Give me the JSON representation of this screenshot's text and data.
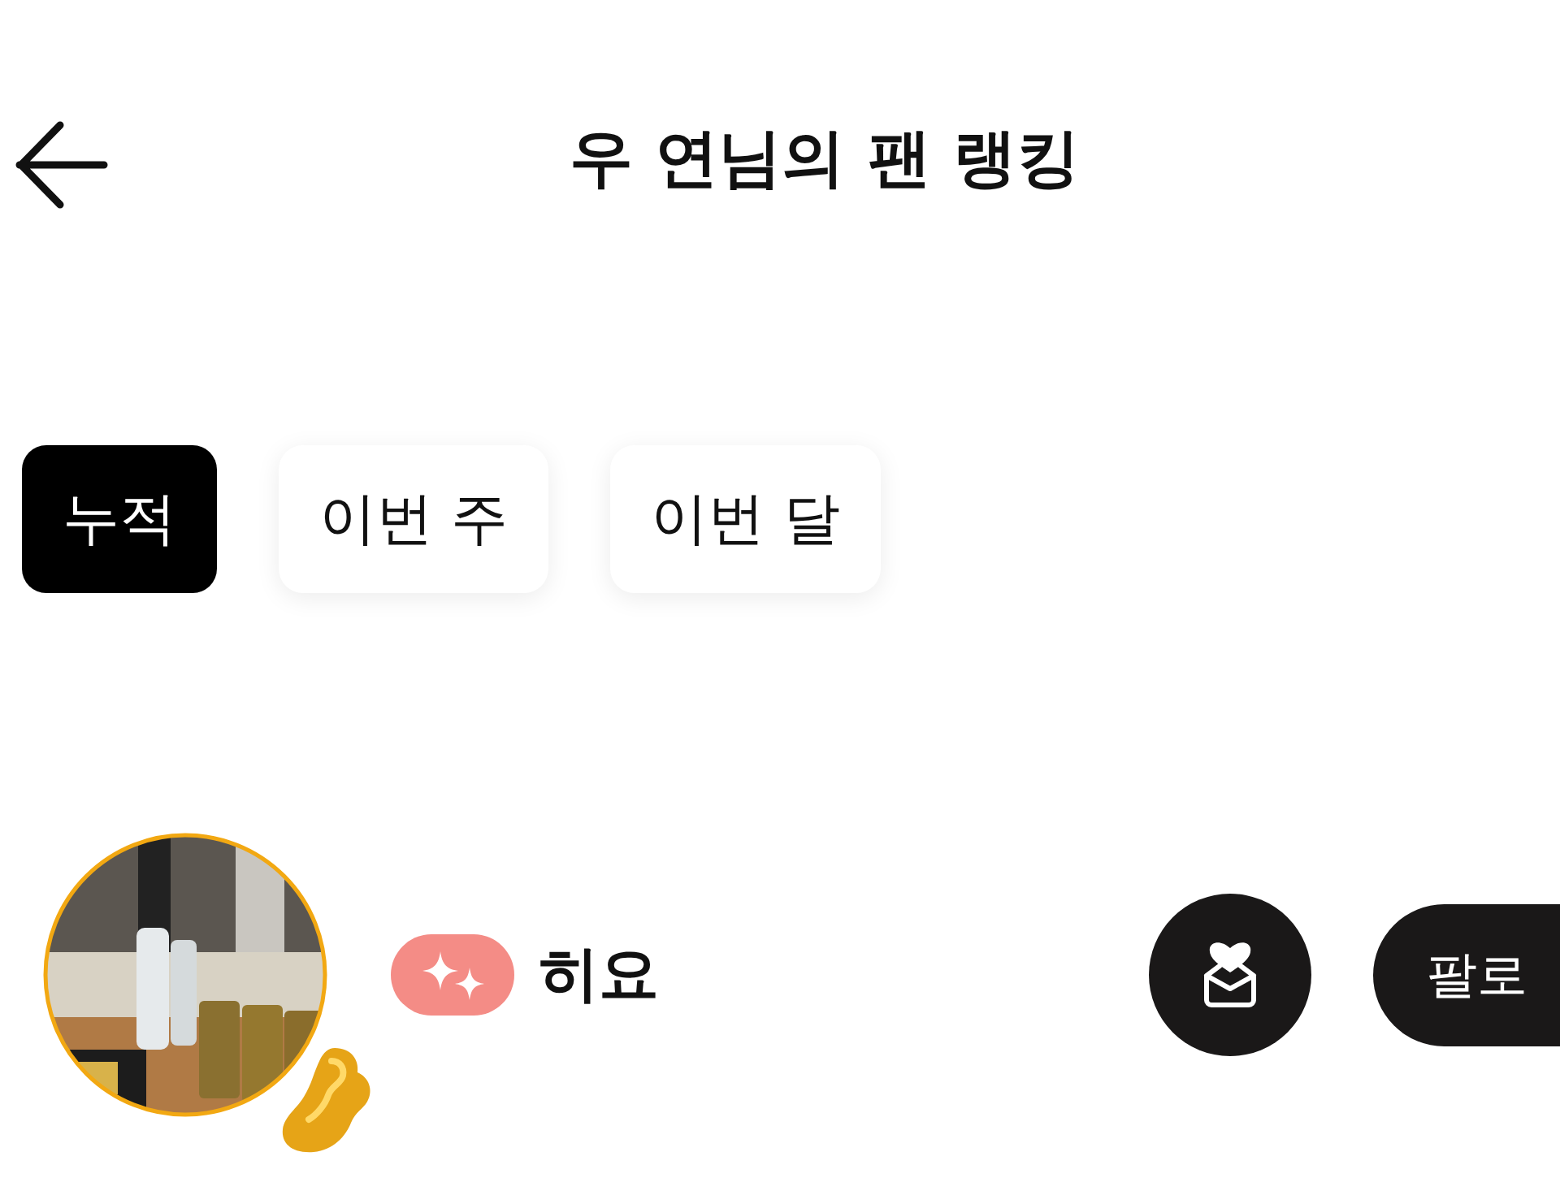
{
  "header": {
    "title": "우 연님의 팬 랭킹"
  },
  "tabs": [
    {
      "label": "누적",
      "selected": true
    },
    {
      "label": "이번 주",
      "selected": false
    },
    {
      "label": "이번 달",
      "selected": false
    }
  ],
  "fans": [
    {
      "name": "히요",
      "follow_label": "팔로"
    }
  ]
}
